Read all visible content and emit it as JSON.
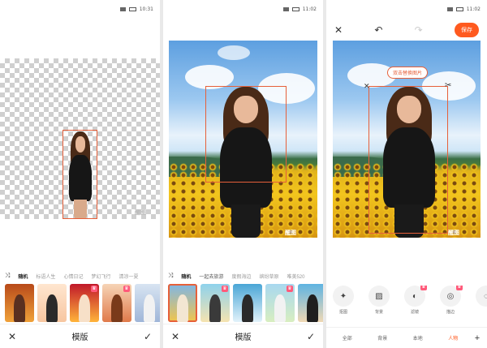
{
  "status": {
    "left_screen_time": "10:31",
    "middle_screen_time": "11:02",
    "right_screen_time": "11:02"
  },
  "screen1": {
    "categories": [
      "随机",
      "标语人生",
      "心情日记",
      "梦幻飞行",
      "清凉一夏"
    ],
    "bottom_title": "模版",
    "watermark": "醒图"
  },
  "screen2": {
    "categories": [
      "随机",
      "一起去旅游",
      "度假海边",
      "缤纷草原",
      "唯美520"
    ],
    "bottom_title": "模版",
    "watermark": "醒图"
  },
  "screen3": {
    "save_label": "保存",
    "hint_pill": "双击替换图片",
    "tools": [
      {
        "label": "抠图",
        "icon": "magic-wand-icon",
        "glyph": "✦"
      },
      {
        "label": "背景",
        "icon": "background-icon",
        "glyph": "▨"
      },
      {
        "label": "滤镜",
        "icon": "filter-icon",
        "glyph": "◐"
      },
      {
        "label": "描边",
        "icon": "outline-icon",
        "glyph": "◎"
      },
      {
        "label": "",
        "icon": "more-tool-icon",
        "glyph": "◌"
      }
    ],
    "tabs": [
      "全部",
      "背景",
      "本地",
      "人物"
    ],
    "active_tab": "人物",
    "watermark": "醒图"
  },
  "colors": {
    "accent": "#e6603a",
    "save_button": "#ff5a1f"
  }
}
